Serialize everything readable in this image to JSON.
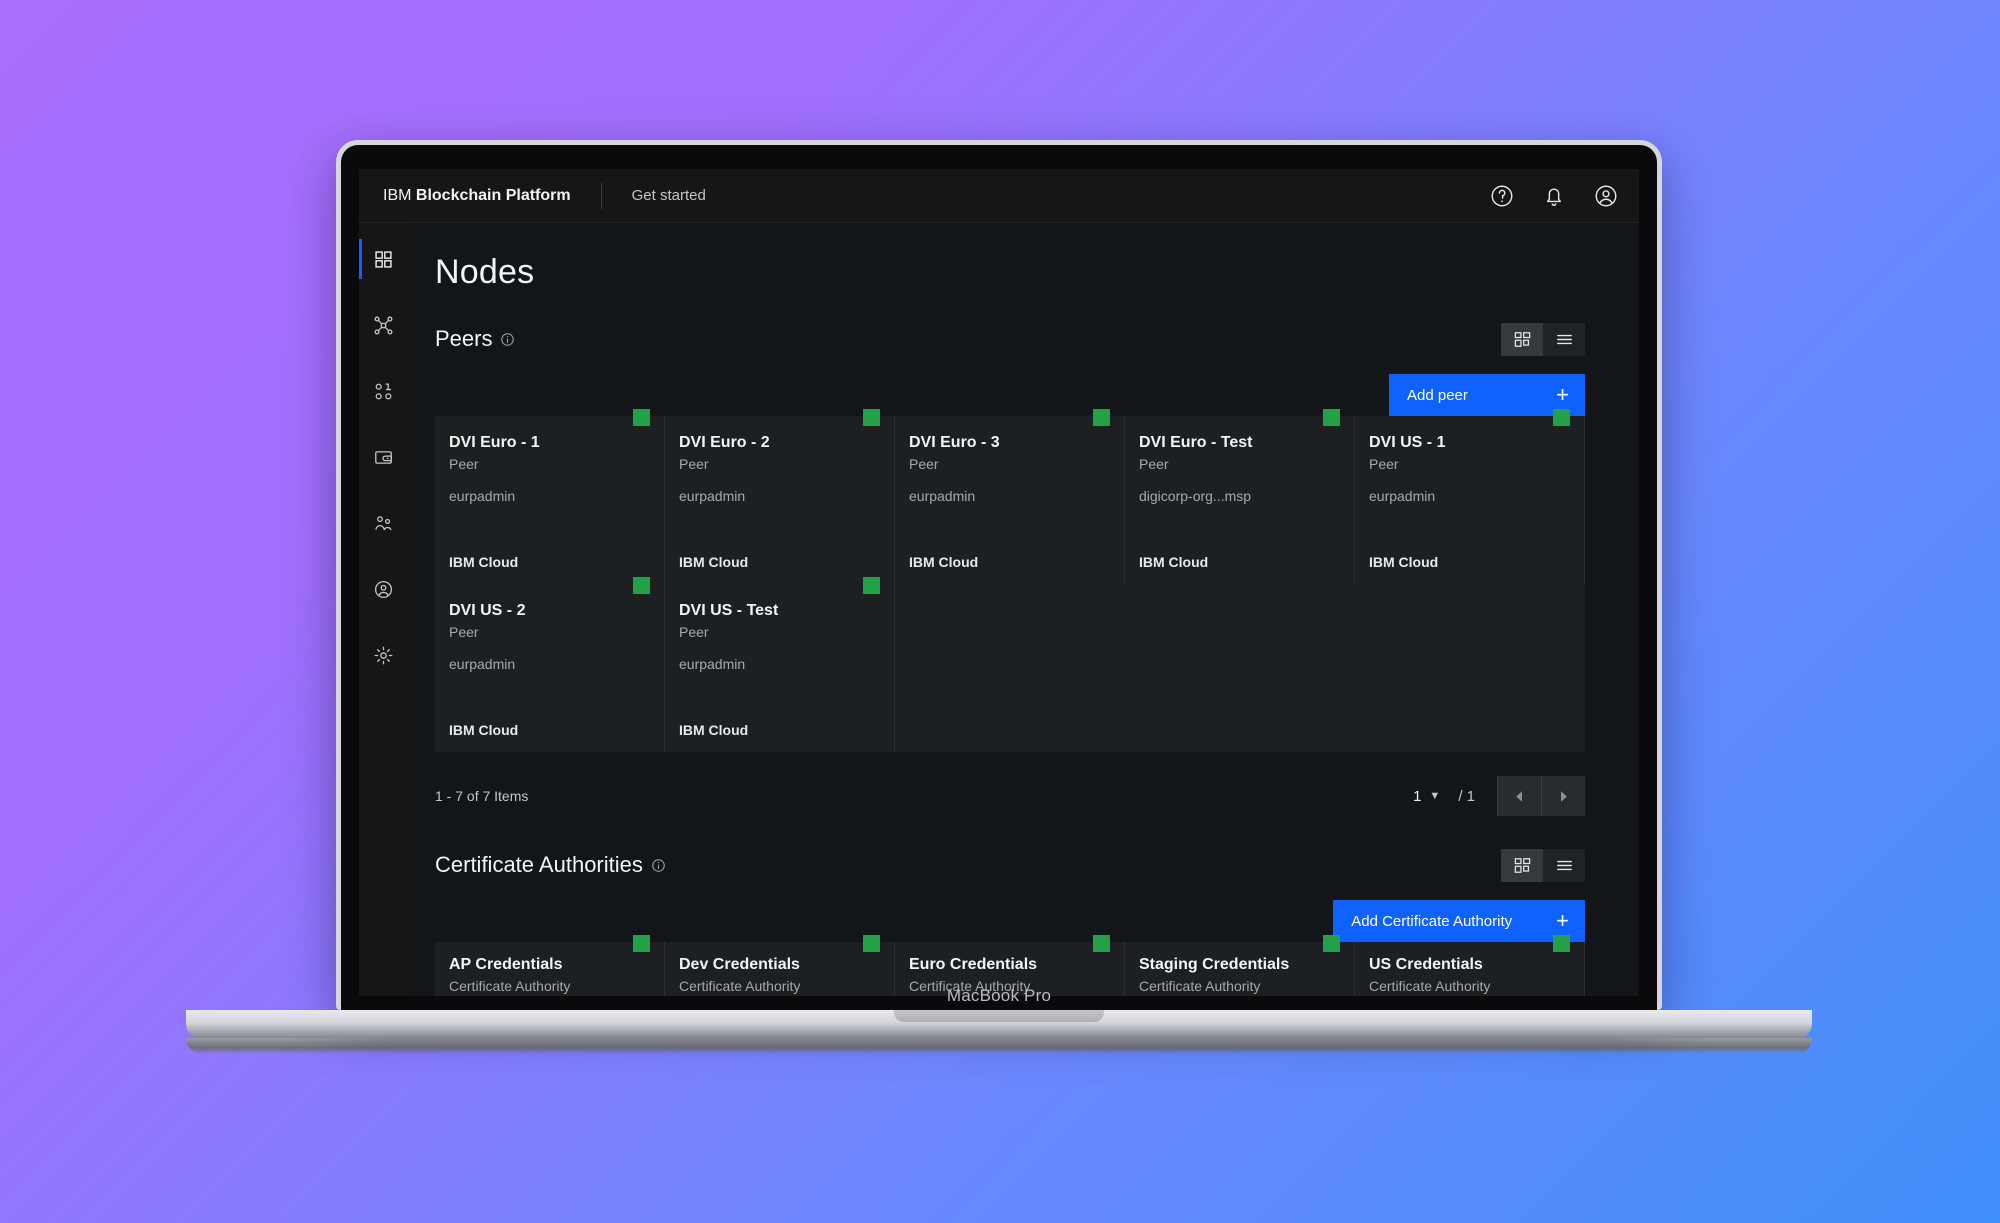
{
  "device": {
    "label": "MacBook Pro"
  },
  "topbar": {
    "brand_prefix": "IBM",
    "brand_name": "Blockchain Platform",
    "get_started": "Get started",
    "icons": [
      "help-icon",
      "notifications-icon",
      "user-account-icon"
    ]
  },
  "rail": {
    "items": [
      {
        "name": "dashboard",
        "icon": "grid-icon",
        "active": true
      },
      {
        "name": "nodes",
        "icon": "network-icon",
        "active": false
      },
      {
        "name": "channels",
        "icon": "channels-icon",
        "active": false
      },
      {
        "name": "smart-contracts",
        "icon": "wallet-icon",
        "active": false
      },
      {
        "name": "organizations",
        "icon": "people-icon",
        "active": false
      },
      {
        "name": "identities",
        "icon": "user-circle-icon",
        "active": false
      },
      {
        "name": "settings",
        "icon": "gear-icon",
        "active": false
      }
    ]
  },
  "page": {
    "title": "Nodes"
  },
  "peers": {
    "title": "Peers",
    "info_icon": "info-icon",
    "view_grid_label": "grid-view",
    "view_list_label": "list-view",
    "active_view": "grid",
    "add_label": "Add peer",
    "add_plus": "+",
    "cards": [
      {
        "name": "DVI Euro - 1",
        "type": "Peer",
        "msp": "eurpadmin",
        "footer": "IBM Cloud",
        "status": "running"
      },
      {
        "name": "DVI Euro - 2",
        "type": "Peer",
        "msp": "eurpadmin",
        "footer": "IBM Cloud",
        "status": "running"
      },
      {
        "name": "DVI Euro - 3",
        "type": "Peer",
        "msp": "eurpadmin",
        "footer": "IBM Cloud",
        "status": "running"
      },
      {
        "name": "DVI Euro - Test",
        "type": "Peer",
        "msp": "digicorp-org...msp",
        "footer": "IBM Cloud",
        "status": "running"
      },
      {
        "name": "DVI US - 1",
        "type": "Peer",
        "msp": "eurpadmin",
        "footer": "IBM Cloud",
        "status": "running"
      },
      {
        "name": "DVI US - 2",
        "type": "Peer",
        "msp": "eurpadmin",
        "footer": "IBM Cloud",
        "status": "running"
      },
      {
        "name": "DVI US - Test",
        "type": "Peer",
        "msp": "eurpadmin",
        "footer": "IBM Cloud",
        "status": "running"
      }
    ],
    "pagination": {
      "range_label": "1 - 7 of 7 Items",
      "current_page": "1",
      "total_pages": "/ 1",
      "prev_label": "previous-page",
      "next_label": "next-page"
    }
  },
  "certificate_authorities": {
    "title": "Certificate Authorities",
    "info_icon": "info-icon",
    "active_view": "grid",
    "add_label": "Add Certificate Authority",
    "add_plus": "+",
    "cards": [
      {
        "name": "AP Credentials",
        "type": "Certificate Authority",
        "status": "running"
      },
      {
        "name": "Dev Credentials",
        "type": "Certificate Authority",
        "status": "running"
      },
      {
        "name": "Euro Credentials",
        "type": "Certificate Authority",
        "status": "running"
      },
      {
        "name": "Staging Credentials",
        "type": "Certificate Authority",
        "status": "running"
      },
      {
        "name": "US Credentials",
        "type": "Certificate Authority",
        "status": "running"
      }
    ]
  },
  "colors": {
    "accent_blue": "#0f62fe",
    "status_green": "#24a148",
    "app_bg": "#121619",
    "card_bg": "#1c2023",
    "backdrop_from": "#a86efc",
    "backdrop_to": "#4090fb"
  }
}
